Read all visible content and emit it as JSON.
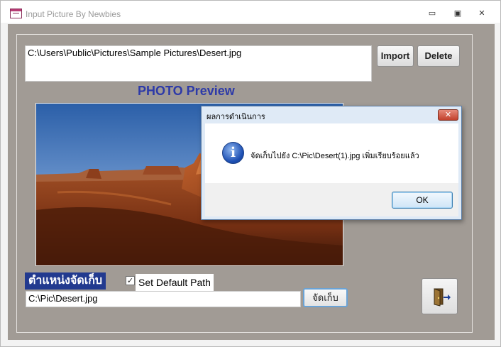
{
  "window": {
    "title": "Input Picture By Newbies",
    "minimize_symbol": "▭",
    "maximize_symbol": "▣",
    "close_symbol": "✕"
  },
  "form": {
    "file_path": "C:\\Users\\Public\\Pictures\\Sample Pictures\\Desert.jpg",
    "import_label": "Import",
    "delete_label": "Delete",
    "photo_title": "PHOTO Preview",
    "location_label": "ตำแหน่งจัดเก็บ",
    "default_path_checked": true,
    "checkbox_mark": "✓",
    "default_path_label": "Set Default Path",
    "save_path": "C:\\Pic\\Desert.jpg",
    "save_label": "จัดเก็บ",
    "exit_icon": "door-exit-icon"
  },
  "dialog": {
    "title": "ผลการดำเนินการ",
    "close_symbol": "✕",
    "icon": "info-icon",
    "icon_glyph": "i",
    "message": "จัดเก็บไปยัง  C:\\Pic\\Desert(1).jpg  เพิ่มเรียบร้อยแล้ว",
    "ok_label": "OK"
  },
  "colors": {
    "form_background": "#a19b95",
    "photo_title": "#2d3aa8",
    "location_label_bg": "#223a8f"
  }
}
